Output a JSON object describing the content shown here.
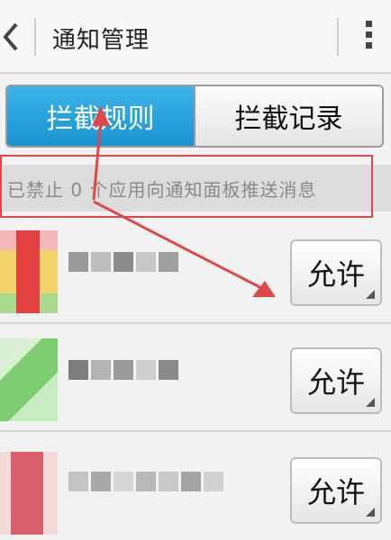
{
  "header": {
    "title": "通知管理",
    "back_icon": "chevron-left-icon",
    "menu_icon": "more-vertical-icon"
  },
  "tabs": [
    {
      "label": "拦截规则",
      "active": true
    },
    {
      "label": "拦截记录",
      "active": false
    }
  ],
  "notice": {
    "text": "已禁止 0 个应用向通知面板推送消息"
  },
  "apps": [
    {
      "name": "",
      "action": "允许"
    },
    {
      "name": "",
      "action": "允许"
    },
    {
      "name": "",
      "action": "允许"
    }
  ],
  "colors": {
    "tab_active": "#1a93d2",
    "annotation": "#e04848"
  }
}
